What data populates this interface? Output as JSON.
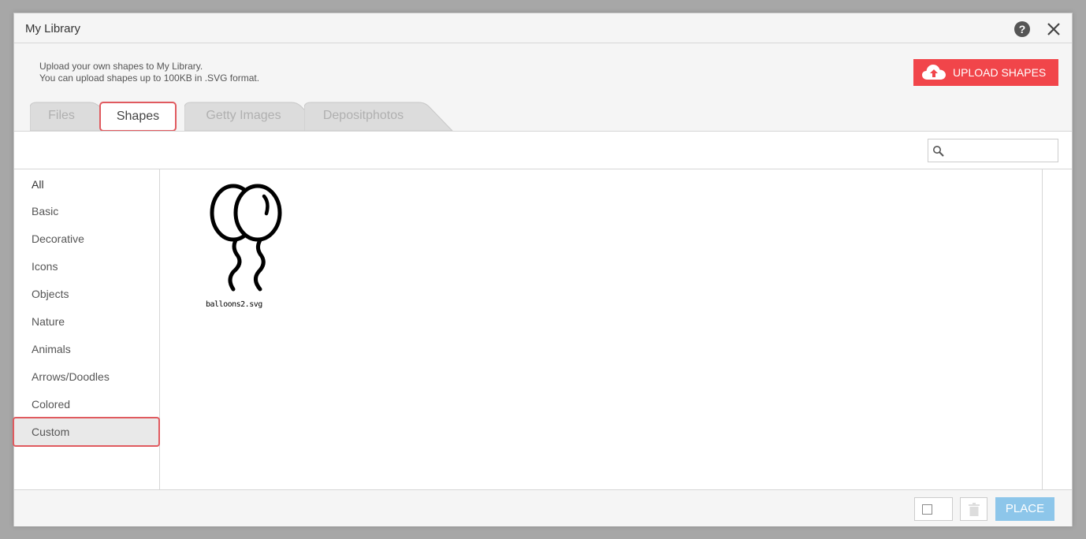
{
  "dialog": {
    "title": "My Library",
    "info_line1": "Upload your own shapes to My Library.",
    "info_line2": "You can upload shapes up to 100KB in .SVG format.",
    "upload_label": "UPLOAD SHAPES",
    "help_icon": "?"
  },
  "tabs": [
    {
      "label": "Files",
      "active": false
    },
    {
      "label": "Shapes",
      "active": true
    },
    {
      "label": "Getty Images",
      "active": false
    },
    {
      "label": "Depositphotos",
      "active": false
    }
  ],
  "search": {
    "placeholder": "",
    "value": ""
  },
  "categories": [
    {
      "label": "All"
    },
    {
      "label": "Basic"
    },
    {
      "label": "Decorative"
    },
    {
      "label": "Icons"
    },
    {
      "label": "Objects"
    },
    {
      "label": "Nature"
    },
    {
      "label": "Animals"
    },
    {
      "label": "Arrows/Doodles"
    },
    {
      "label": "Colored"
    },
    {
      "label": "Custom",
      "active": true
    }
  ],
  "shapes": [
    {
      "file_name": "balloons2.svg",
      "icon": "balloons-icon"
    }
  ],
  "footer": {
    "place_label": "PLACE"
  },
  "colors": {
    "accent": "#f1454a",
    "active_outline": "#e05a5f",
    "place_button": "#8dc6ea"
  }
}
